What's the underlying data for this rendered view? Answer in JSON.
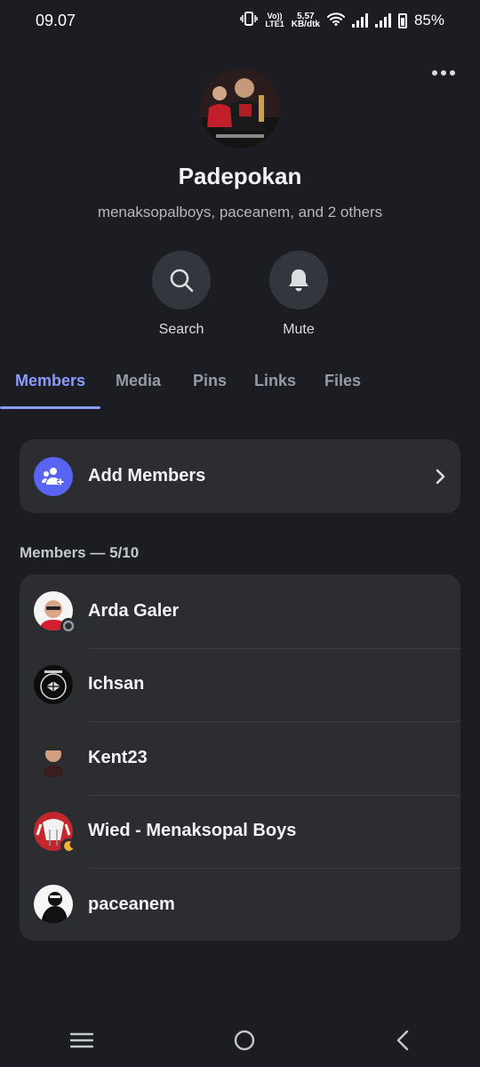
{
  "status_bar": {
    "time": "09.07",
    "network_top": "Vo))",
    "network_bottom": "LTE1",
    "speed_top": "5,57",
    "speed_bottom": "KB/dtk",
    "battery": "85%"
  },
  "header": {
    "more_icon": "more-horizontal-icon"
  },
  "group": {
    "name": "Padepokan",
    "subtitle": "menaksopalboys, paceanem, and 2 others"
  },
  "actions": {
    "search_label": "Search",
    "mute_label": "Mute"
  },
  "tabs": {
    "active": "Members",
    "items": [
      {
        "label": "Members"
      },
      {
        "label": "Media"
      },
      {
        "label": "Pins"
      },
      {
        "label": "Links"
      },
      {
        "label": "Files"
      }
    ]
  },
  "add_members": {
    "label": "Add Members"
  },
  "members": {
    "section_title": "Members — 5/10",
    "list": [
      {
        "name": "Arda Galer",
        "presence": "idle"
      },
      {
        "name": "Ichsan",
        "presence": "none"
      },
      {
        "name": "Kent23",
        "presence": "none"
      },
      {
        "name": "Wied - Menaksopal Boys",
        "presence": "moon"
      },
      {
        "name": "paceanem",
        "presence": "none"
      }
    ]
  },
  "colors": {
    "background": "#1c1d22",
    "card": "#2b2d31",
    "accent": "#8c9bff",
    "blurple": "#5865f2"
  }
}
